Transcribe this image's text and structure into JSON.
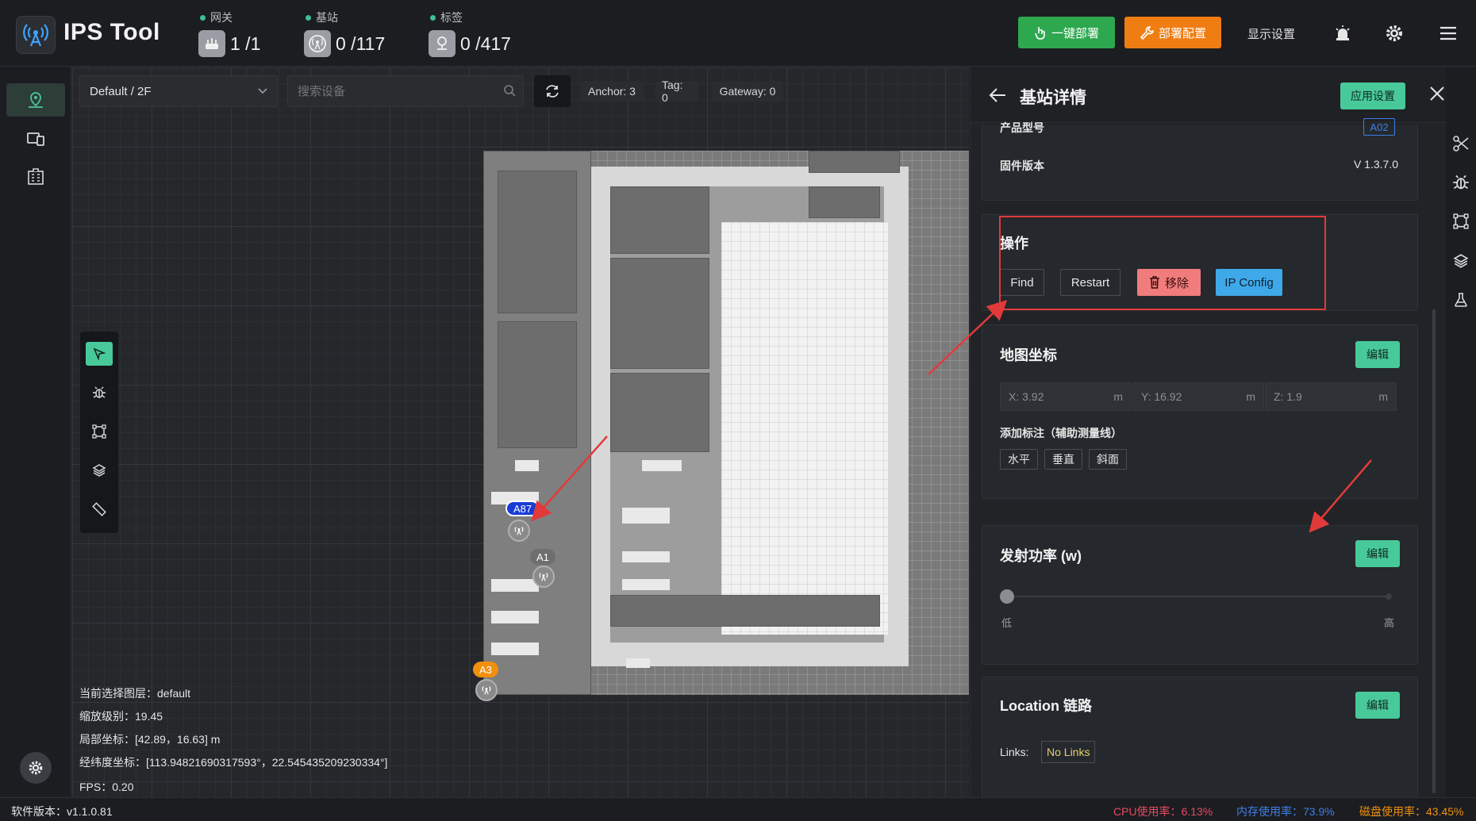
{
  "app": {
    "title": "IPS Tool"
  },
  "header": {
    "stats": [
      {
        "label": "网关",
        "value": "1 /1",
        "icon": "gateway-icon"
      },
      {
        "label": "基站",
        "value": "0 /117",
        "icon": "anchor-icon"
      },
      {
        "label": "标签",
        "value": "0 /417",
        "icon": "tag-icon"
      }
    ],
    "deploy_button": "一键部署",
    "config_button": "部署配置",
    "display_settings": "显示设置",
    "colors": {
      "green": "#2ea84f",
      "orange": "#f07d12",
      "accent": "#48c99a"
    }
  },
  "leftnav": {
    "items": [
      "map-pin-icon",
      "devices-icon",
      "building-icon"
    ],
    "bottom": "gear-icon"
  },
  "map": {
    "floor_select": "Default / 2F",
    "search_placeholder": "搜索设备",
    "chips": [
      "Anchor: 3",
      "Tag: 0",
      "Gateway: 0"
    ],
    "markers": [
      {
        "label": "A87",
        "color": "#1a3bd6"
      },
      {
        "label": "A1",
        "color": "#6e6e6e"
      },
      {
        "label": "A3",
        "color": "#f0900e"
      }
    ],
    "info": [
      {
        "label": "当前选择图层：",
        "value": "default"
      },
      {
        "label": "缩放级别：",
        "value": "19.45"
      },
      {
        "label": "局部坐标：",
        "value": "[42.89，16.63] m"
      },
      {
        "label": "经纬度坐标：",
        "value": "[113.94821690317593°，22.545435209230334°]"
      },
      {
        "label": "FPS：",
        "value": "0.20"
      }
    ]
  },
  "panel": {
    "title": "基站详情",
    "apply_button": "应用设置",
    "partial_label": "产品型号",
    "partial_value": "A02",
    "firmware": {
      "label": "固件版本",
      "value": "V 1.3.7.0"
    },
    "operations": {
      "title": "操作",
      "find": "Find",
      "restart": "Restart",
      "remove": "移除",
      "ip_config": "IP Config"
    },
    "map_coords": {
      "title": "地图坐标",
      "edit": "编辑",
      "x": "X: 3.92",
      "y": "Y: 16.92",
      "z": "Z: 1.9",
      "unit": "m",
      "aux_label": "添加标注（辅助测量线）",
      "aux_buttons": [
        "水平",
        "垂直",
        "斜面"
      ]
    },
    "power": {
      "title": "发射功率 (w)",
      "edit": "编辑",
      "low": "低",
      "high": "高",
      "level": 0
    },
    "location": {
      "title": "Location 链路",
      "edit": "编辑",
      "links_label": "Links:",
      "links_value": "No Links"
    }
  },
  "statusbar": {
    "version_label": "软件版本：",
    "version": "v1.1.0.81",
    "cpu_label": "CPU使用率：",
    "cpu": "6.13%",
    "mem_label": "内存使用率：",
    "mem": "73.9%",
    "disk_label": "磁盘使用率：",
    "disk": "43.45%",
    "colors": {
      "cpu": "#e84a5f",
      "mem": "#3f7fe8",
      "disk": "#f0900e"
    }
  }
}
